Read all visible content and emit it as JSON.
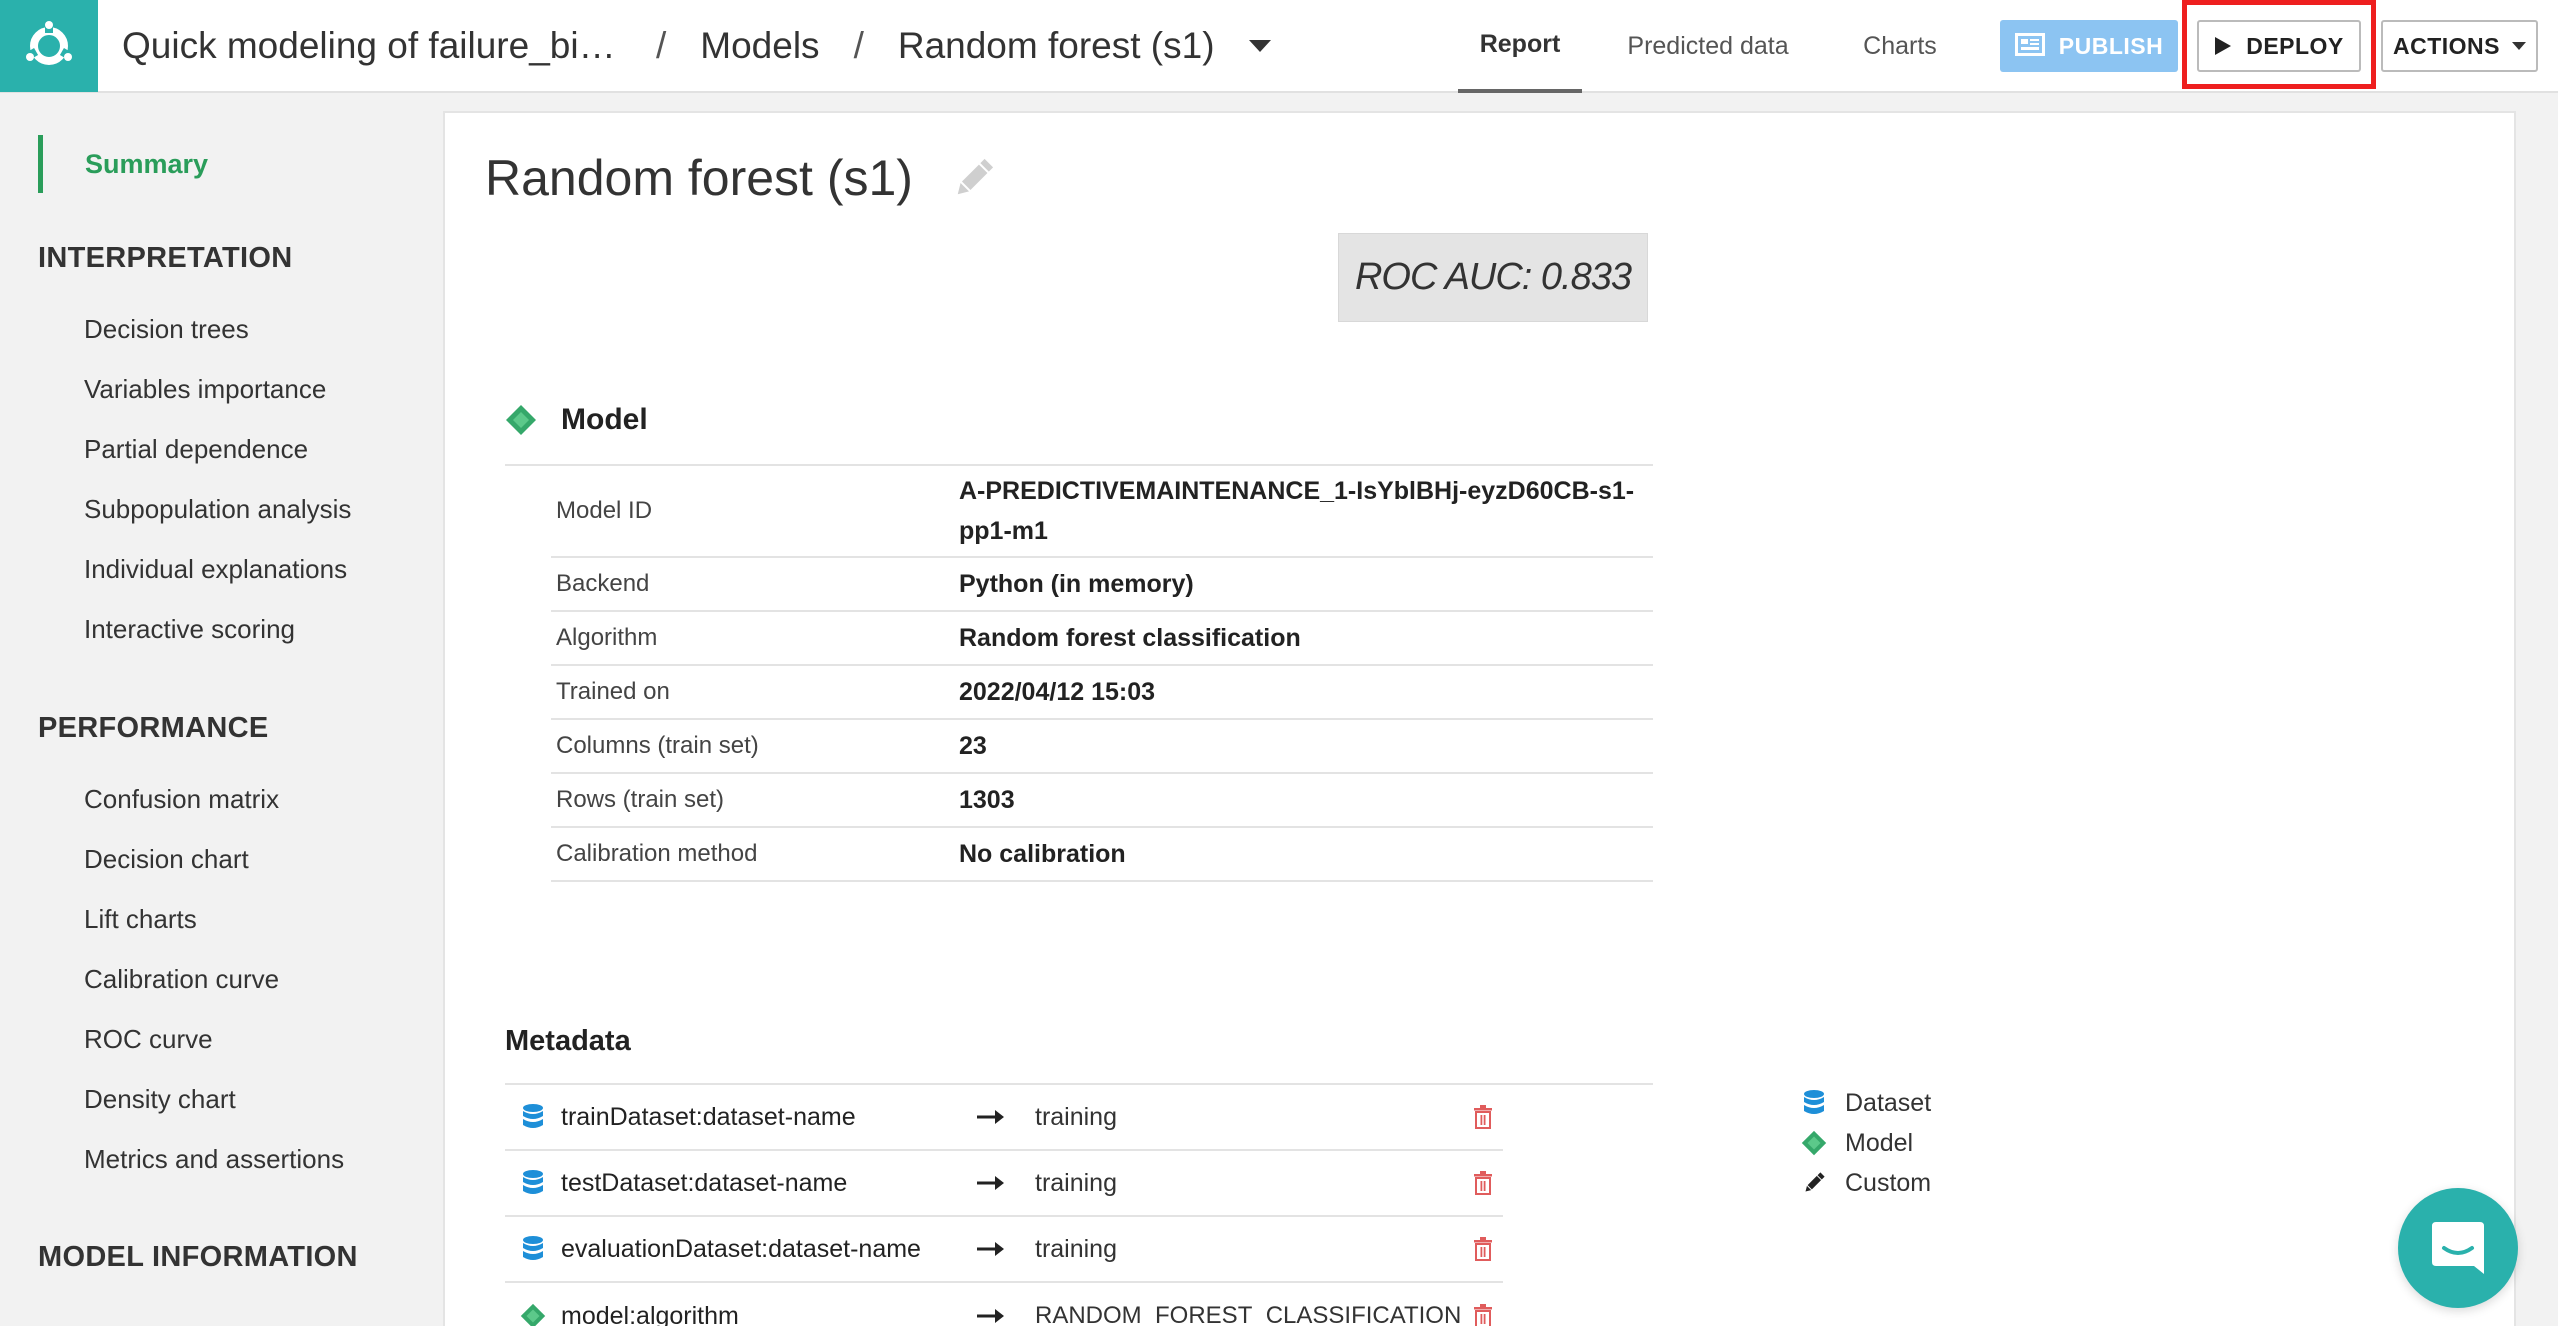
{
  "header": {
    "breadcrumb": {
      "project": "Quick modeling of failure_bi…",
      "models": "Models",
      "model": "Random forest (s1)"
    },
    "tabs": [
      {
        "label": "Report",
        "active": true
      },
      {
        "label": "Predicted data",
        "active": false
      },
      {
        "label": "Charts",
        "active": false
      }
    ],
    "publish_label": "PUBLISH",
    "deploy_label": "DEPLOY",
    "actions_label": "ACTIONS",
    "brand_color": "#2ab1ac",
    "highlight_color": "#ee1f1f"
  },
  "sidebar": {
    "summary": "Summary",
    "sections": [
      {
        "title": "INTERPRETATION",
        "items": [
          "Decision trees",
          "Variables importance",
          "Partial dependence",
          "Subpopulation analysis",
          "Individual explanations",
          "Interactive scoring"
        ]
      },
      {
        "title": "PERFORMANCE",
        "items": [
          "Confusion matrix",
          "Decision chart",
          "Lift charts",
          "Calibration curve",
          "ROC curve",
          "Density chart",
          "Metrics and assertions"
        ]
      },
      {
        "title": "MODEL INFORMATION",
        "items": []
      }
    ]
  },
  "main": {
    "title": "Random forest (s1)",
    "roc_auc": "ROC AUC: 0.833",
    "model_section": {
      "label": "Model",
      "rows": [
        {
          "key": "Model ID",
          "value": "A-PREDICTIVEMAINTENANCE_1-IsYblBHj-eyzD60CB-s1-pp1-m1"
        },
        {
          "key": "Backend",
          "value": "Python (in memory)"
        },
        {
          "key": "Algorithm",
          "value": "Random forest classification"
        },
        {
          "key": "Trained on",
          "value": "2022/04/12 15:03"
        },
        {
          "key": "Columns (train set)",
          "value": "23"
        },
        {
          "key": "Rows (train set)",
          "value": "1303"
        },
        {
          "key": "Calibration method",
          "value": "No calibration"
        }
      ]
    },
    "metadata_section": {
      "label": "Metadata",
      "rows": [
        {
          "icon": "dataset-icon",
          "key": "trainDataset:dataset-name",
          "value": "training"
        },
        {
          "icon": "dataset-icon",
          "key": "testDataset:dataset-name",
          "value": "training"
        },
        {
          "icon": "dataset-icon",
          "key": "evaluationDataset:dataset-name",
          "value": "training"
        },
        {
          "icon": "model-icon",
          "key": "model:algorithm",
          "value": "RANDOM_FOREST_CLASSIFICATION"
        }
      ],
      "legend": [
        {
          "icon": "dataset-icon",
          "label": "Dataset"
        },
        {
          "icon": "model-icon",
          "label": "Model"
        },
        {
          "icon": "pencil-icon",
          "label": "Custom"
        }
      ]
    }
  }
}
